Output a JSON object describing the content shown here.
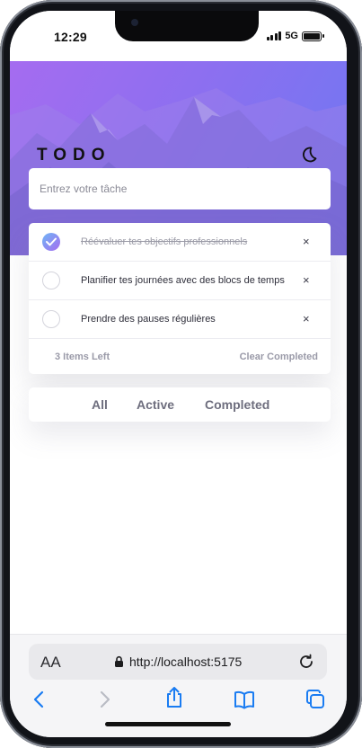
{
  "status": {
    "time": "12:29",
    "network": "5G"
  },
  "app": {
    "title": "TODO"
  },
  "input": {
    "placeholder": "Entrez votre tâche"
  },
  "todos": [
    {
      "text": "Réévaluer tes objectifs professionnels",
      "completed": true,
      "delete_label": "×"
    },
    {
      "text": "Planifier tes journées avec des blocs de temps",
      "completed": false,
      "delete_label": "×"
    },
    {
      "text": "Prendre des pauses régulières",
      "completed": false,
      "delete_label": "×"
    }
  ],
  "footer": {
    "items_left": "3 Items Left",
    "clear_completed": "Clear Completed"
  },
  "filters": {
    "all": "All",
    "active": "Active",
    "completed": "Completed"
  },
  "browser": {
    "text_size": "AA",
    "url": "http://localhost:5175"
  },
  "icons": {
    "theme_toggle": "moon-icon",
    "lock": "lock-icon",
    "reload": "reload-icon",
    "back": "chevron-left-icon",
    "forward": "chevron-right-icon",
    "share": "share-icon",
    "bookmarks": "book-icon",
    "tabs": "tabs-icon"
  },
  "colors": {
    "accent_blue": "#1a7cf2",
    "gradient_start": "#a56cf0",
    "gradient_end": "#6d78f2"
  }
}
